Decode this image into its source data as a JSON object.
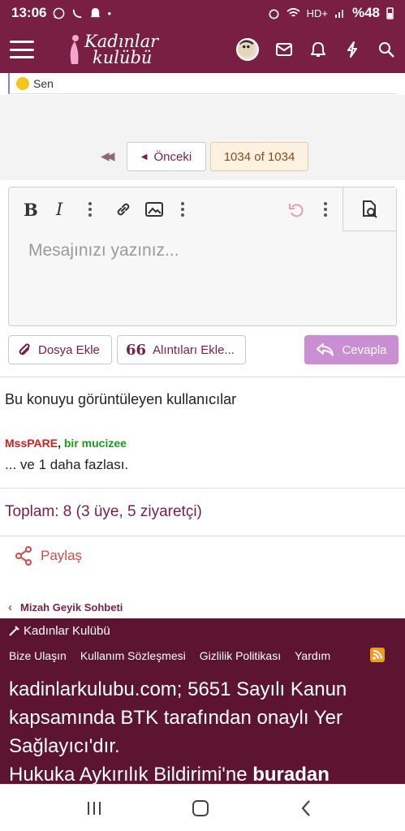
{
  "status_bar": {
    "time": "13:06",
    "network": "HD+",
    "battery": "%48"
  },
  "header": {
    "logo_line1": "Kadınlar",
    "logo_line2": "kulübü"
  },
  "reaction": {
    "text": "Sen"
  },
  "pagination": {
    "prev_label": "Önceki",
    "current": "1034 of 1034"
  },
  "editor": {
    "placeholder": "Mesajınızı yazınız...",
    "bold_label": "B",
    "italic_label": "I"
  },
  "actions": {
    "attach_label": "Dosya Ekle",
    "quotes_label": "Alıntıları Ekle...",
    "reply_label": "Cevapla"
  },
  "viewers": {
    "title": "Bu konuyu görüntüleyen kullanıcılar",
    "user1": "MssPARE",
    "user2": "bir mucizee",
    "more": "... ve 1 daha fazlası.",
    "total": "Toplam: 8 (3 üye, 5 ziyaretçi)"
  },
  "share": {
    "label": "Paylaş"
  },
  "breadcrumb": {
    "label": "Mizah Geyik Sohbeti"
  },
  "footer": {
    "brand": "Kadınlar Kulübü",
    "links": [
      "Bize Ulaşın",
      "Kullanım Sözleşmesi",
      "Gizlilik Politikası",
      "Yardım"
    ],
    "text": "kadinlarkulubu.com; 5651 Sayılı Kanun kapsamında BTK tarafından onaylı Yer Sağlayıcı'dır.",
    "text2_prefix": "Hukuka Aykırılık Bildirimi'ne ",
    "text2_link": "buradan"
  },
  "colors": {
    "brand": "#7a1f44",
    "footer_bg": "#5c1430",
    "reply_button": "#c98fd2",
    "user1": "#d42020",
    "user2": "#1a9a1a"
  }
}
